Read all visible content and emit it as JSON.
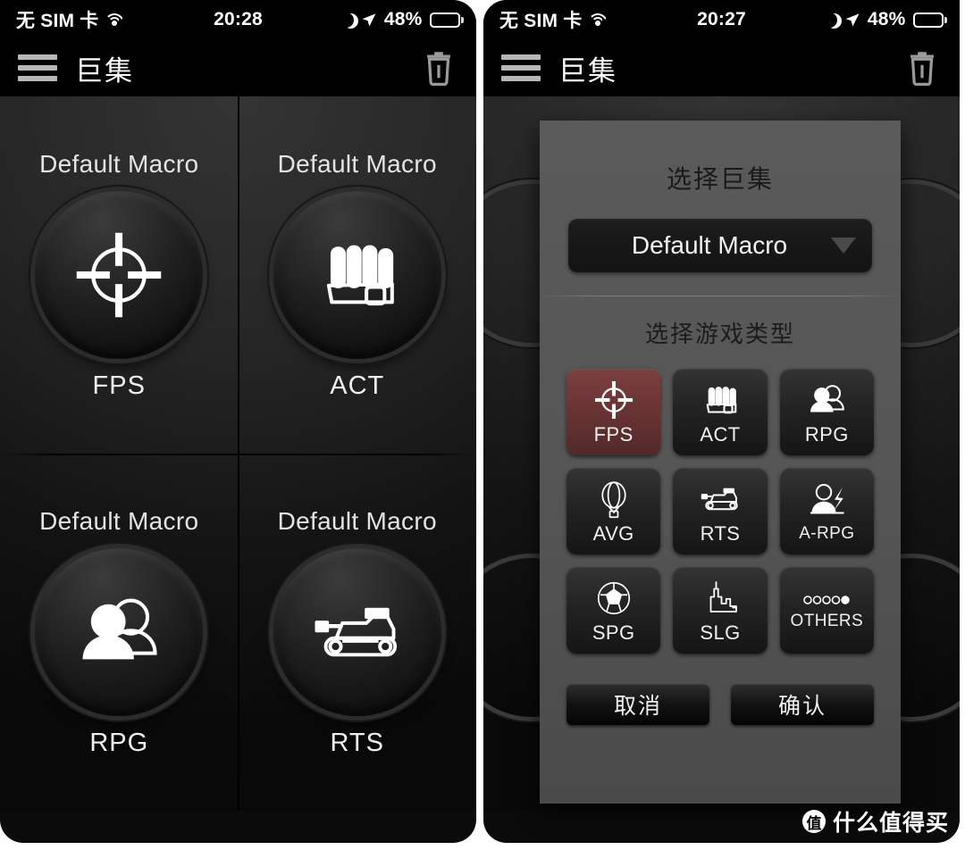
{
  "app": {
    "title": "巨集",
    "menu_icon": "hamburger-icon",
    "delete_icon": "trash-icon"
  },
  "status_bar_left": {
    "carrier": "无 SIM 卡",
    "wifi_icon": "wifi-icon",
    "time": "20:28",
    "moon_icon": "moon-icon",
    "location_icon": "location-arrow-icon",
    "battery_text": "48%",
    "battery_percent": 48
  },
  "status_bar_right": {
    "carrier": "无 SIM 卡",
    "wifi_icon": "wifi-icon",
    "time": "20:27",
    "moon_icon": "moon-icon",
    "location_icon": "location-arrow-icon",
    "battery_text": "48%",
    "battery_percent": 48
  },
  "macro_grid": {
    "cells": [
      {
        "name": "Default Macro",
        "type": "FPS",
        "icon": "crosshair-icon"
      },
      {
        "name": "Default Macro",
        "type": "ACT",
        "icon": "fist-icon"
      },
      {
        "name": "Default Macro",
        "type": "RPG",
        "icon": "two-people-icon"
      },
      {
        "name": "Default Macro",
        "type": "RTS",
        "icon": "tank-icon"
      }
    ]
  },
  "dialog": {
    "title": "选择巨集",
    "macro_dropdown": {
      "value": "Default Macro",
      "caret_icon": "chevron-down-icon"
    },
    "subtitle": "选择游戏类型",
    "game_types": [
      {
        "label": "FPS",
        "icon": "crosshair-icon",
        "selected": true
      },
      {
        "label": "ACT",
        "icon": "fist-icon",
        "selected": false
      },
      {
        "label": "RPG",
        "icon": "two-people-icon",
        "selected": false
      },
      {
        "label": "AVG",
        "icon": "balloon-icon",
        "selected": false
      },
      {
        "label": "RTS",
        "icon": "tank-icon",
        "selected": false
      },
      {
        "label": "A-RPG",
        "icon": "hero-bolt-icon",
        "selected": false
      },
      {
        "label": "SPG",
        "icon": "soccer-ball-icon",
        "selected": false
      },
      {
        "label": "SLG",
        "icon": "skyline-icon",
        "selected": false
      },
      {
        "label": "OTHERS",
        "icon": "dots-icon",
        "selected": false
      }
    ],
    "cancel_label": "取消",
    "confirm_label": "确认",
    "selected_color": "#6b3434"
  },
  "watermark": {
    "badge": "值",
    "text": "什么值得买"
  }
}
